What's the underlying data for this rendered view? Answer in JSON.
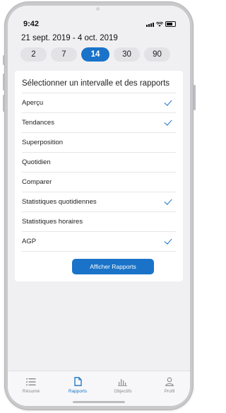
{
  "status_bar": {
    "time": "9:42"
  },
  "date_range": "21 sept. 2019 - 4 oct. 2019",
  "segments": [
    {
      "label": "2",
      "active": false
    },
    {
      "label": "7",
      "active": false
    },
    {
      "label": "14",
      "active": true
    },
    {
      "label": "30",
      "active": false
    },
    {
      "label": "90",
      "active": false
    }
  ],
  "card": {
    "title": "Sélectionner un intervalle et des rapports",
    "reports": [
      {
        "label": "Aperçu",
        "checked": true
      },
      {
        "label": "Tendances",
        "checked": true
      },
      {
        "label": "Superposition",
        "checked": false
      },
      {
        "label": "Quotidien",
        "checked": false
      },
      {
        "label": "Comparer",
        "checked": false
      },
      {
        "label": "Statistiques quotidiennes",
        "checked": true
      },
      {
        "label": "Statistiques horaires",
        "checked": false
      },
      {
        "label": "AGP",
        "checked": true
      }
    ],
    "button_label": "Afficher Rapports"
  },
  "tabbar": {
    "items": [
      {
        "label": "Résumé",
        "icon": "list-icon",
        "active": false
      },
      {
        "label": "Rapports",
        "icon": "document-icon",
        "active": true
      },
      {
        "label": "Objectifs",
        "icon": "bar-chart-icon",
        "active": false
      },
      {
        "label": "Profil",
        "icon": "person-icon",
        "active": false
      }
    ]
  },
  "colors": {
    "accent": "#1a73c8",
    "background": "#f0f0f3",
    "inactive_tab": "#8a8a8e"
  }
}
